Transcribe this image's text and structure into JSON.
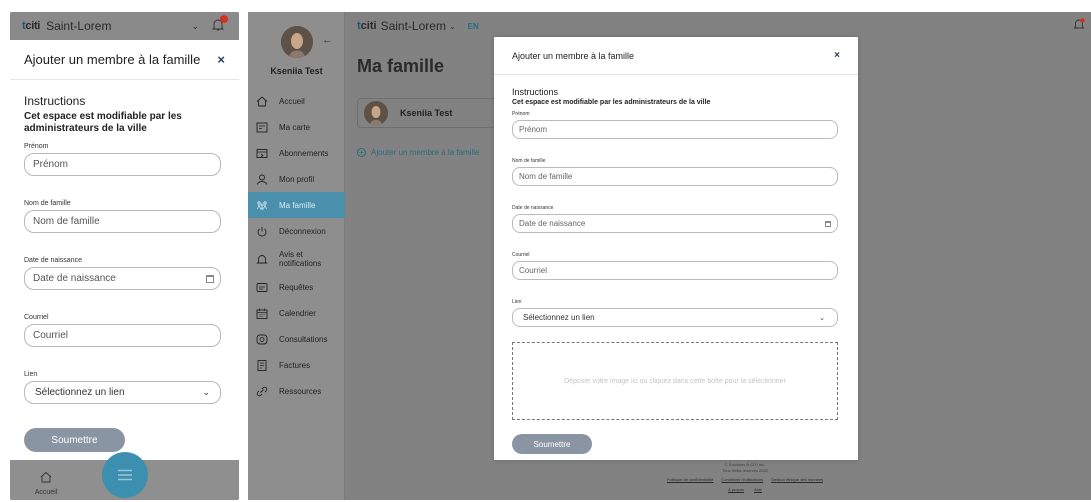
{
  "brand": {
    "logo_prefix": "t",
    "logo_rest": "citi",
    "city": "Saint-Lorem",
    "language": "EN"
  },
  "colors": {
    "accent": "#4a90ad",
    "submit_bg": "#8a95a3",
    "badge": "#d0321d",
    "link": "#2a6b7e"
  },
  "mobile": {
    "modal": {
      "title": "Ajouter un membre à la famille",
      "close": "×",
      "instructions": "Instructions",
      "instructions_sub": "Cet espace est modifiable par les administrateurs de la ville",
      "fields": {
        "prenom_label": "Prénom",
        "prenom_placeholder": "Prénom",
        "nom_label": "Nom de famille",
        "nom_placeholder": "Nom de famille",
        "date_label": "Date de naissance",
        "date_placeholder": "Date de naissance",
        "courriel_label": "Courriel",
        "courriel_placeholder": "Courriel",
        "lien_label": "Lien",
        "lien_value": "Sélectionnez un lien"
      },
      "submit": "Soumettre"
    },
    "bottom_nav": {
      "home_label": "Accueil"
    }
  },
  "desktop": {
    "user_name": "Kseniia Test",
    "nav": [
      {
        "label": "Accueil",
        "icon": "home-icon"
      },
      {
        "label": "Ma carte",
        "icon": "card-icon"
      },
      {
        "label": "Abonnements",
        "icon": "subscriptions-icon"
      },
      {
        "label": "Mon profil",
        "icon": "user-icon"
      },
      {
        "label": "Ma famille",
        "icon": "family-icon"
      },
      {
        "label": "Déconnexion",
        "icon": "power-icon"
      },
      {
        "label": "Avis et notifications",
        "icon": "bell-icon"
      },
      {
        "label": "Requêtes",
        "icon": "requests-icon"
      },
      {
        "label": "Calendrier",
        "icon": "calendar-icon"
      },
      {
        "label": "Consultations",
        "icon": "consultations-icon"
      },
      {
        "label": "Factures",
        "icon": "invoice-icon"
      },
      {
        "label": "Ressources",
        "icon": "link-icon"
      }
    ],
    "page_title": "Ma famille",
    "member_name": "Kseniia Test",
    "add_member": "Ajouter un membre à la famille",
    "modal": {
      "title": "Ajouter un membre à la famille",
      "close": "×",
      "instructions": "Instructions",
      "instructions_sub": "Cet espace est modifiable par les administrateurs de la ville",
      "fields": {
        "prenom_label": "Prénom",
        "prenom_placeholder": "Prénom",
        "nom_label": "Nom de famille",
        "nom_placeholder": "Nom de famille",
        "date_label": "Date de naissance",
        "date_placeholder": "Date de naissance",
        "courriel_label": "Courriel",
        "courriel_placeholder": "Courriel",
        "lien_label": "Lien",
        "lien_value": "Sélectionnez un lien"
      },
      "dropzone": "Déposer votre image ici ou cliquez dans cette boîte pour la sélectionner",
      "submit": "Soumettre"
    },
    "footer": {
      "copyright": "© Solutions B-CITI inc.",
      "rights": "Tous droits réservés 2022",
      "links": [
        "Politique de confidentialité",
        "Conditions d'utilisations",
        "Gestion éthique des données"
      ],
      "links2": [
        "À propos",
        "Aide"
      ]
    }
  }
}
